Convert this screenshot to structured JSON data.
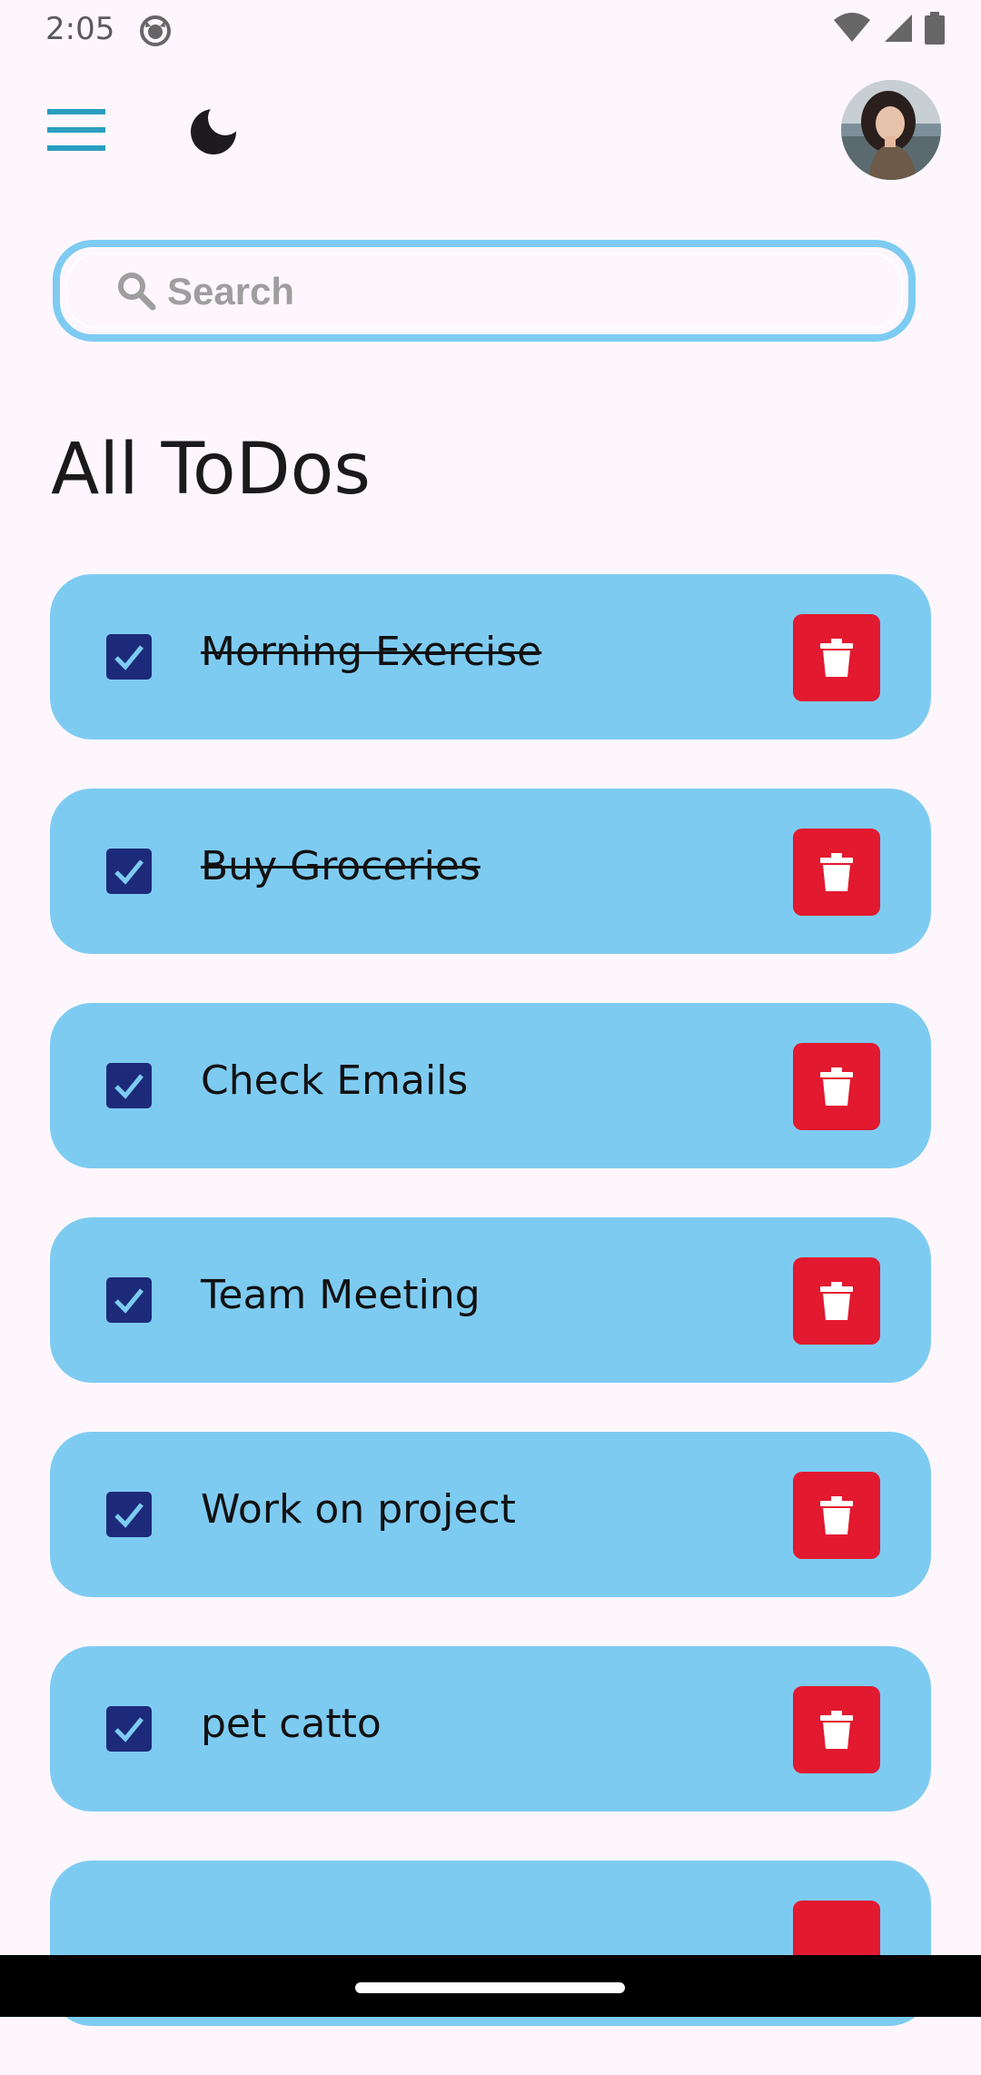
{
  "status_bar": {
    "time": "2:05"
  },
  "search": {
    "placeholder": "Search"
  },
  "page": {
    "title": "All ToDos"
  },
  "todos": [
    {
      "label": "Morning Exercise",
      "completed": true
    },
    {
      "label": "Buy Groceries",
      "completed": true
    },
    {
      "label": "Check Emails",
      "completed": false
    },
    {
      "label": "Team Meeting",
      "completed": false
    },
    {
      "label": "Work on project",
      "completed": false
    },
    {
      "label": "pet catto",
      "completed": false
    },
    {
      "label": "",
      "completed": false
    }
  ],
  "colors": {
    "background": "#fdf7fd",
    "card": "#7ecbf2",
    "checkbox": "#1d2a7a",
    "delete": "#e2192f",
    "menu": "#2b9ec0"
  }
}
